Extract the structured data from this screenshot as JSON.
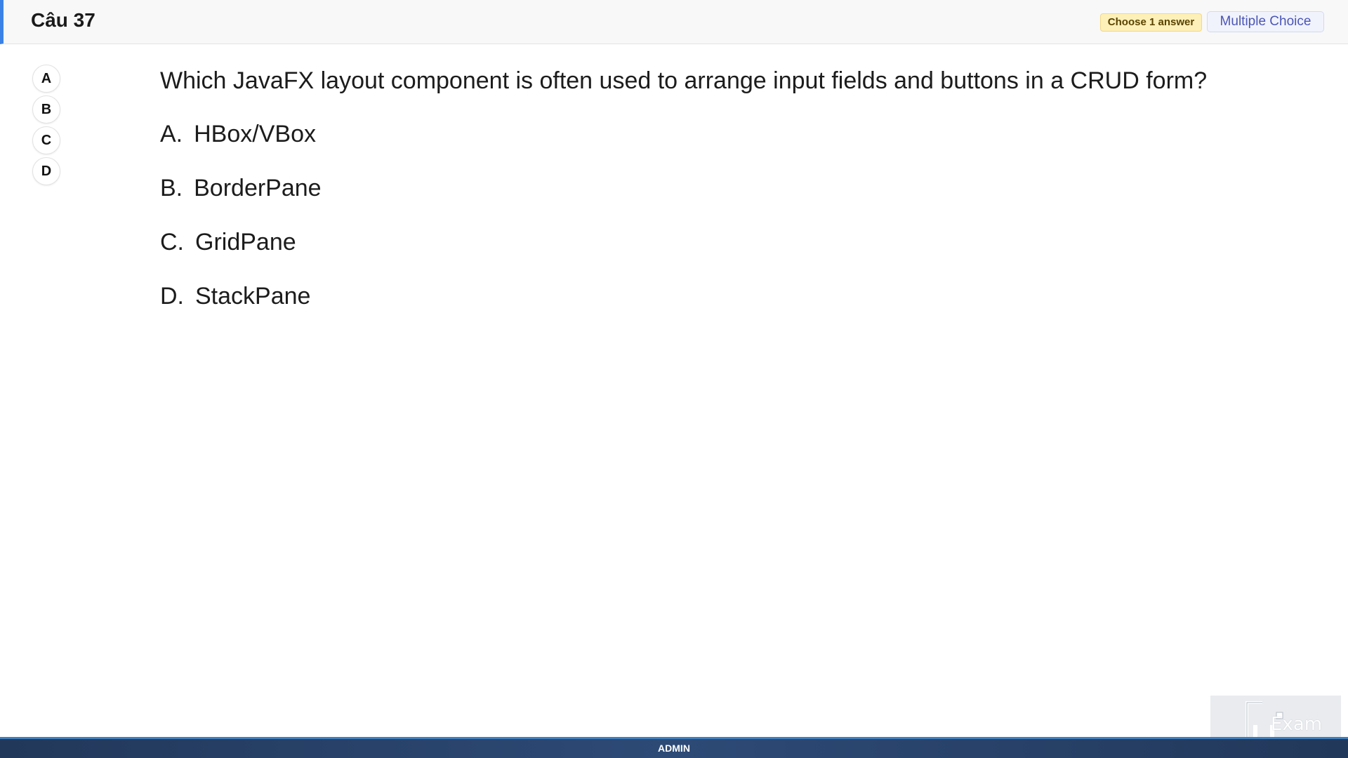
{
  "header": {
    "title": "Câu 37",
    "choose_badge": "Choose 1 answer",
    "type_badge": "Multiple Choice"
  },
  "answer_nav": [
    "A",
    "B",
    "C",
    "D"
  ],
  "question": {
    "text": "Which JavaFX layout component is often used to arrange input fields and buttons in a CRUD form?",
    "options": [
      {
        "letter": "A.",
        "text": "HBox/VBox"
      },
      {
        "letter": "B.",
        "text": "BorderPane"
      },
      {
        "letter": "C.",
        "text": "GridPane"
      },
      {
        "letter": "D.",
        "text": "StackPane"
      }
    ]
  },
  "footer": {
    "label": "ADMIN"
  },
  "logo": {
    "text": "Exam"
  },
  "colors": {
    "accent": "#3b82e6",
    "footer": "#2d4a76",
    "badge_yellow": "#fdf0b8",
    "badge_blue": "#f1f3fc"
  }
}
